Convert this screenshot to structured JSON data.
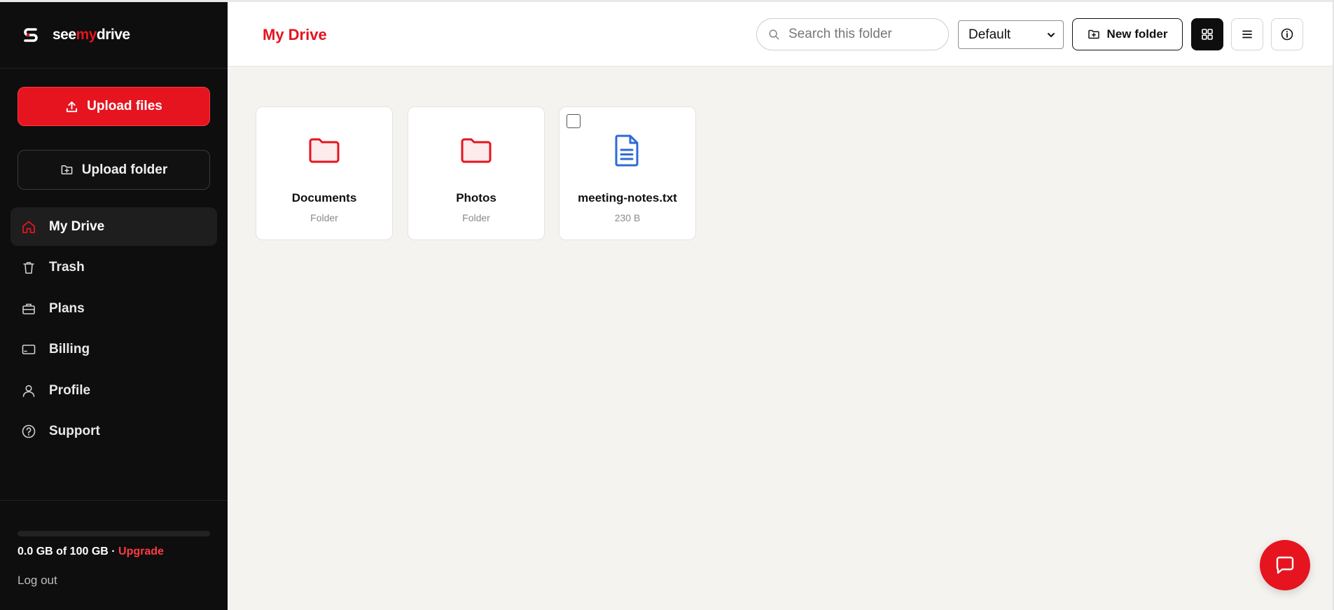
{
  "brand": {
    "name_prefix": "see",
    "name_accent": "my",
    "name_suffix": "drive",
    "accent_color": "#e5141f",
    "logo_icon": "s-logo-icon"
  },
  "sidebar": {
    "upload_files_label": "Upload files",
    "upload_folder_label": "Upload folder",
    "items": [
      {
        "label": "My Drive",
        "icon": "home-icon",
        "active": true
      },
      {
        "label": "Trash",
        "icon": "trash-icon",
        "active": false
      },
      {
        "label": "Plans",
        "icon": "briefcase-icon",
        "active": false
      },
      {
        "label": "Billing",
        "icon": "card-icon",
        "active": false
      },
      {
        "label": "Profile",
        "icon": "user-icon",
        "active": false
      },
      {
        "label": "Support",
        "icon": "help-icon",
        "active": false
      }
    ],
    "storage": {
      "used_text": "0.0 GB of 100 GB · ",
      "upgrade_label": "Upgrade",
      "fill_fraction": 0.0
    },
    "logout_label": "Log out"
  },
  "header": {
    "title": "My Drive",
    "search_placeholder": "Search this folder",
    "sort_value": "Default",
    "new_folder_label": "New folder",
    "view_mode": "grid"
  },
  "items": [
    {
      "name": "Documents",
      "meta": "Folder",
      "type": "folder",
      "icon": "folder-icon"
    },
    {
      "name": "Photos",
      "meta": "Folder",
      "type": "folder",
      "icon": "folder-icon"
    },
    {
      "name": "meeting-notes.txt",
      "meta": "230 B",
      "type": "file",
      "icon": "document-icon"
    }
  ]
}
